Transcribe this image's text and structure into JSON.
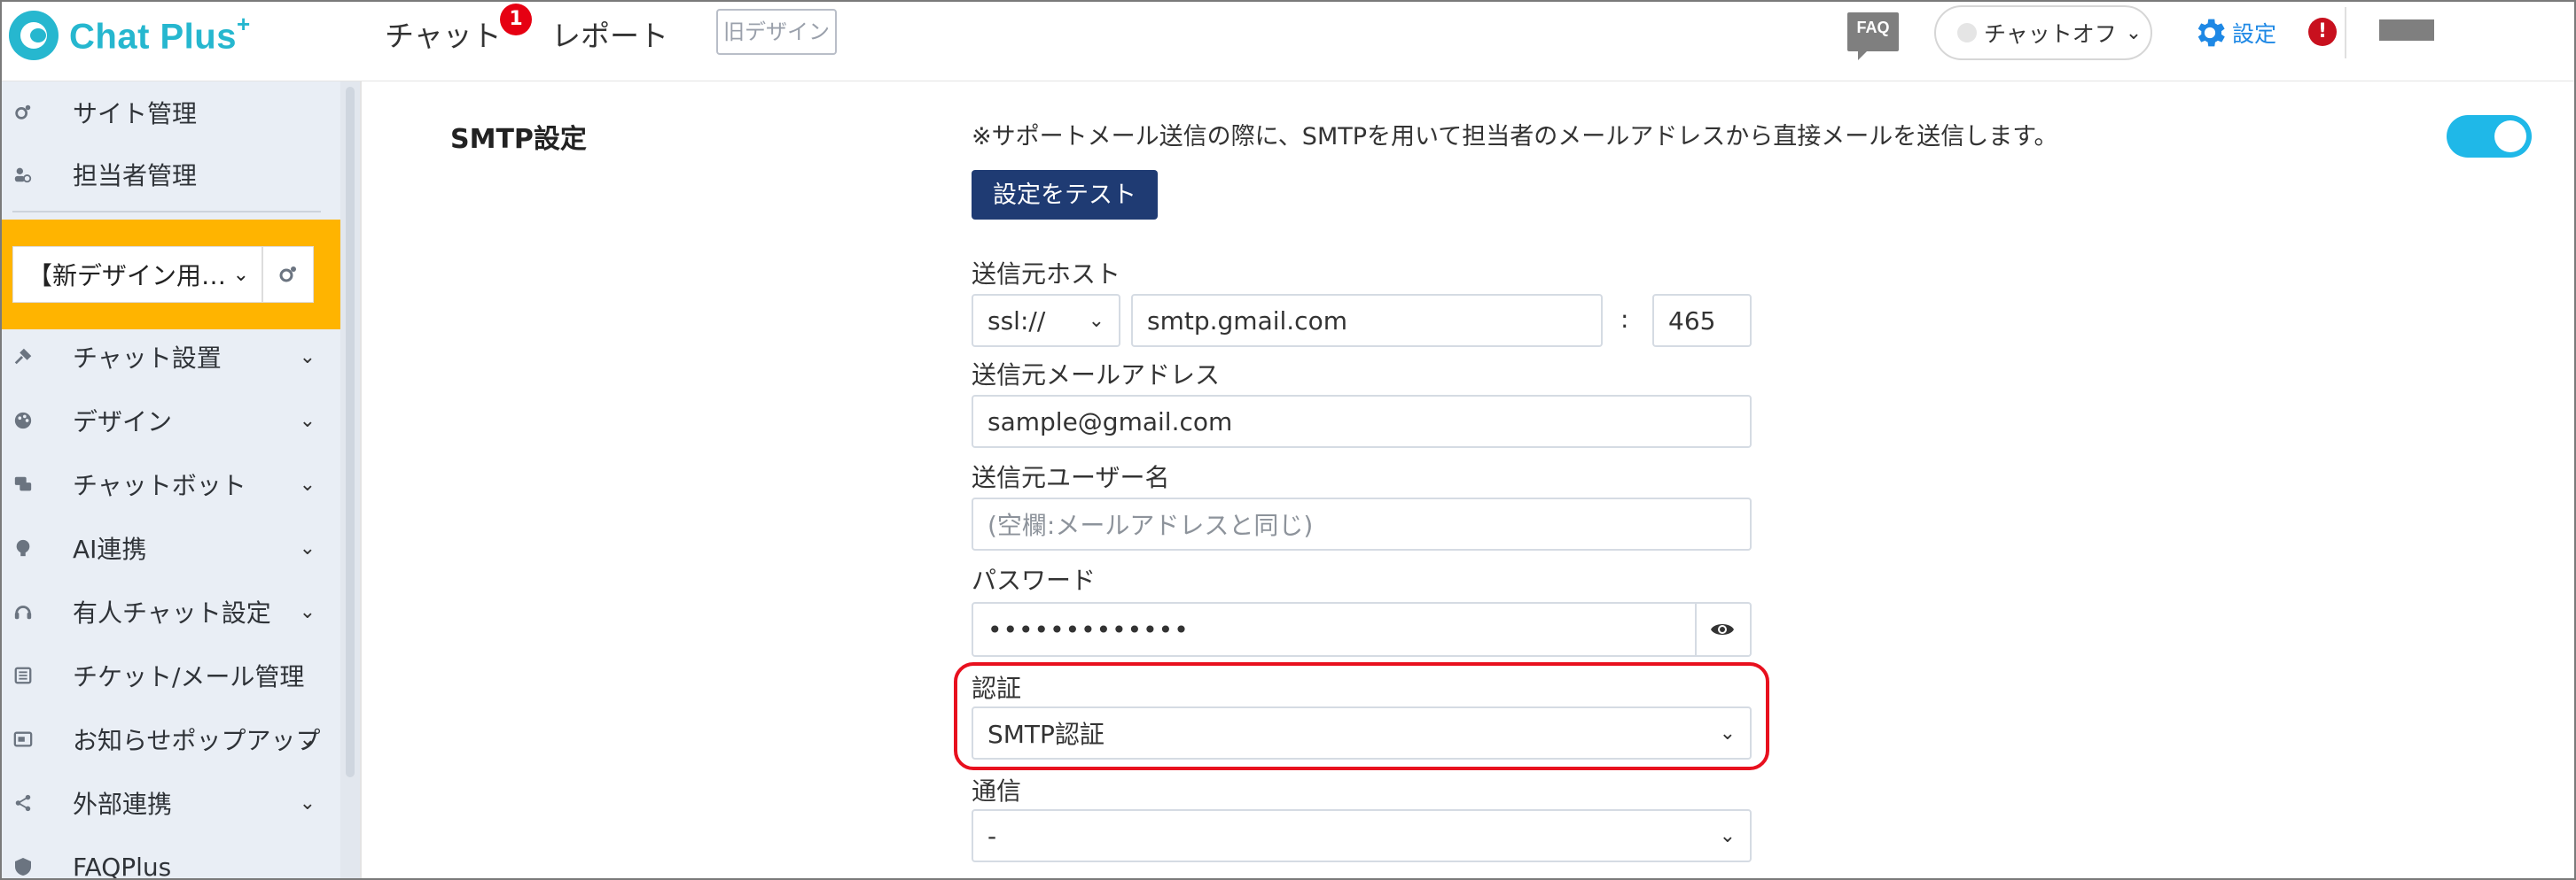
{
  "header": {
    "logo_text": "Chat Plus",
    "logo_sup": "+",
    "nav_chat": "チャット",
    "nav_chat_badge": "1",
    "nav_report": "レポート",
    "old_design": "旧デザイン",
    "faq": "FAQ",
    "chat_status": "チャットオフ",
    "settings": "設定",
    "alert": "!"
  },
  "sidebar": {
    "items": [
      {
        "label": "サイト管理",
        "icon": "gears-icon"
      },
      {
        "label": "担当者管理",
        "icon": "users-icon"
      },
      {
        "label": "チャット設置",
        "icon": "tools-icon"
      },
      {
        "label": "デザイン",
        "icon": "palette-icon"
      },
      {
        "label": "チャットボット",
        "icon": "chat-bubbles-icon"
      },
      {
        "label": "AI連携",
        "icon": "brain-icon"
      },
      {
        "label": "有人チャット設定",
        "icon": "headset-icon"
      },
      {
        "label": "チケット/メール管理",
        "icon": "ticket-list-icon"
      },
      {
        "label": "お知らせポップアップ",
        "icon": "popup-icon"
      },
      {
        "label": "外部連携",
        "icon": "share-icon"
      },
      {
        "label": "FAQPlus",
        "icon": "faq-shield-icon"
      }
    ],
    "site_select": "【新デザイン用…"
  },
  "main": {
    "section_title": "SMTP設定",
    "description": "※サポートメール送信の際に、SMTPを用いて担当者のメールアドレスから直接メールを送信します。",
    "test_button": "設定をテスト",
    "host_label": "送信元ホスト",
    "protocol": "ssl://",
    "host": "smtp.gmail.com",
    "colon": ":",
    "port": "465",
    "email_label": "送信元メールアドレス",
    "email": "sample@gmail.com",
    "username_label": "送信元ユーザー名",
    "username_placeholder": "(空欄:メールアドレスと同じ)",
    "password_label": "パスワード",
    "password": "•••••••••••••",
    "auth_label": "認証",
    "auth_value": "SMTP認証",
    "comm_label": "通信",
    "comm_value": "-"
  },
  "colors": {
    "brand": "#26b7cf",
    "accent_blue": "#1e88e5",
    "button_navy": "#1f3b73",
    "toggle_on": "#1fb8e8",
    "highlight_red": "#e8101e",
    "site_box_yellow": "#ffb400",
    "sidebar_bg": "#e9eef5"
  }
}
